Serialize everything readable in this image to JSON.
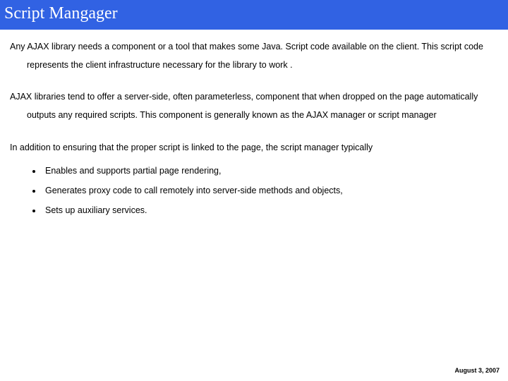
{
  "header": {
    "title": "Script Mangager"
  },
  "body": {
    "para1": "Any AJAX library needs a component or a tool that makes some Java. Script code available on the client. This script code represents the client infrastructure necessary for the library to work .",
    "para2": "AJAX libraries tend to offer a server-side, often parameterless, component that when dropped on the page automatically outputs any required scripts. This component is generally known as the AJAX manager or script manager",
    "para3_lead": "In addition to ensuring that the proper script is linked to the page, the script manager typically",
    "bullets": [
      "Enables and supports partial page rendering,",
      "Generates proxy code to call remotely into server-side methods and objects,",
      "Sets up auxiliary services."
    ]
  },
  "footer": {
    "date": "August 3, 2007"
  }
}
